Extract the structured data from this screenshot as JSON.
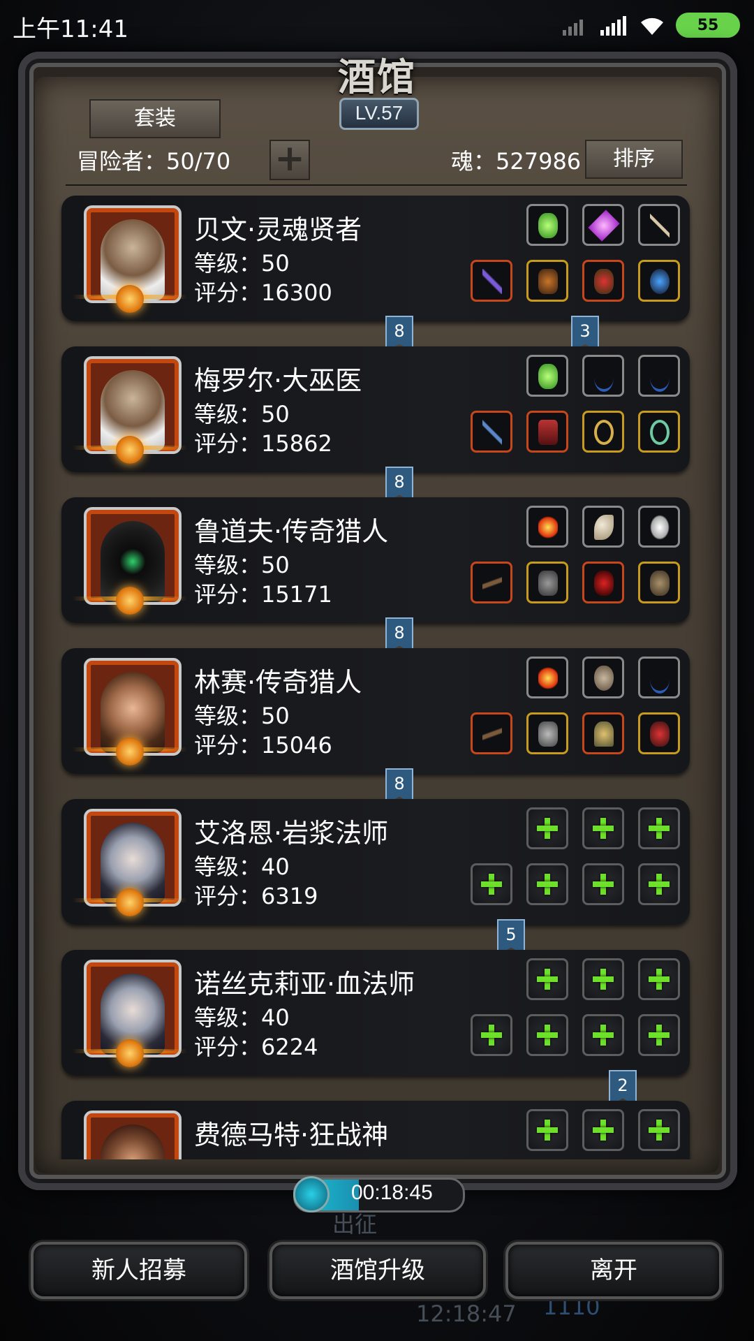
{
  "status_bar": {
    "time": "上午11:41",
    "battery": "55"
  },
  "header": {
    "title": "酒馆",
    "level": "LV.57",
    "suit_button": "套装",
    "adventurer_count": "冒险者：50/70",
    "soul_count": "魂：527986",
    "sort_button": "排序"
  },
  "heroes": [
    {
      "name": "贝文·灵魂贤者",
      "level": "等级：50",
      "score": "评分：16300",
      "slots_top": [
        "gem-green",
        "gem-purple",
        "staff"
      ],
      "slots_bottom": [
        "staff",
        "armor",
        "helm",
        "amulet"
      ],
      "bookmarks": [
        "8",
        "3"
      ]
    },
    {
      "name": "梅罗尔·大巫医",
      "level": "等级：50",
      "score": "评分：15862",
      "slots_top": [
        "gem-green",
        "bow",
        "bow"
      ],
      "slots_bottom": [
        "scepter",
        "robe",
        "ring",
        "ring"
      ],
      "bookmarks": [
        "8"
      ]
    },
    {
      "name": "鲁道夫·传奇猎人",
      "level": "等级：50",
      "score": "评分：15171",
      "slots_top": [
        "fire-orb",
        "tooth",
        "feather"
      ],
      "slots_bottom": [
        "rifle",
        "armor",
        "helm",
        "gloves"
      ],
      "bookmarks": [
        "8"
      ]
    },
    {
      "name": "林赛·传奇猎人",
      "level": "等级：50",
      "score": "评分：15046",
      "slots_top": [
        "fire-orb",
        "shield",
        "bow"
      ],
      "slots_bottom": [
        "rifle",
        "armor",
        "helm",
        "gloves"
      ],
      "bookmarks": [
        "8"
      ]
    },
    {
      "name": "艾洛恩·岩浆法师",
      "level": "等级：40",
      "score": "评分：6319",
      "slots_top": [
        "empty",
        "empty",
        "empty"
      ],
      "slots_bottom": [
        "empty",
        "empty",
        "empty",
        "empty"
      ],
      "bookmarks": [
        "5"
      ]
    },
    {
      "name": "诺丝克莉亚·血法师",
      "level": "等级：40",
      "score": "评分：6224",
      "slots_top": [
        "empty",
        "empty",
        "empty"
      ],
      "slots_bottom": [
        "empty",
        "empty",
        "empty",
        "empty"
      ],
      "bookmarks": [
        "2"
      ]
    },
    {
      "name": "费德马特·狂战神",
      "level": "",
      "score": "",
      "slots_top": [
        "empty",
        "empty",
        "empty"
      ],
      "slots_bottom": [],
      "bookmarks": []
    }
  ],
  "timer": {
    "text": "00:18:45",
    "progress": 0.38
  },
  "footer": {
    "recruit_button": "新人招募",
    "upgrade_button": "酒馆升级",
    "leave_button": "离开",
    "background_label": "出征",
    "background_time": "12:18:47",
    "background_value": "1110"
  },
  "colors": {
    "plus_green": "#6ee02a",
    "bookmark_blue": "#2f5a80",
    "portrait_orange": "#c3480f"
  }
}
